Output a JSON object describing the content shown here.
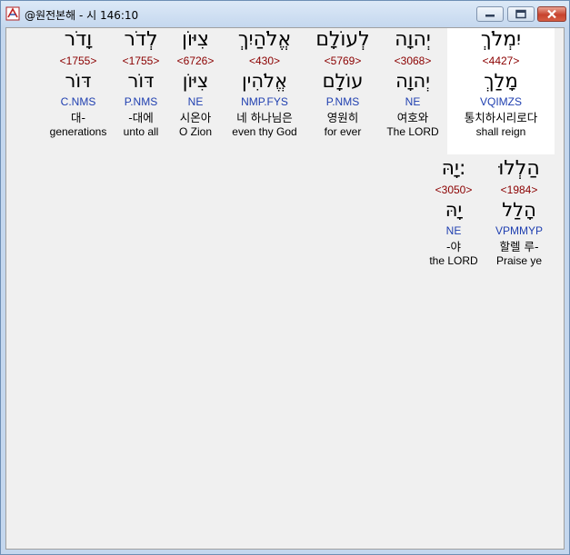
{
  "window": {
    "title": "@원전본해 - 시 146:10",
    "controls": {
      "minimize": "minimize",
      "maximize": "maximize",
      "close": "close"
    }
  },
  "row1": [
    {
      "hebrew": "יִמְלֹךְ",
      "strong": "<4427>",
      "lemma": "מָלַךְ",
      "parse": "VQIMZS",
      "korean": "통치하시리로다",
      "english": "shall reign",
      "selected": true
    },
    {
      "hebrew": "יְהוָה",
      "strong": "<3068>",
      "lemma": "יְהוָה",
      "parse": "NE",
      "korean": "여호와",
      "english": "The LORD"
    },
    {
      "hebrew": "לְעוֹלָם",
      "strong": "<5769>",
      "lemma": "עוֹלָם",
      "parse": "P.NMS",
      "korean": "영원히",
      "english": "for ever"
    },
    {
      "hebrew": "אֱלֹהַיִךְ",
      "strong": "<430>",
      "lemma": "אֱלֹהִין",
      "parse": "NMP.FYS",
      "korean": "네 하나님은",
      "english": "even thy God"
    },
    {
      "hebrew": "צִיּוֹן",
      "strong": "<6726>",
      "lemma": "צִיּוֹן",
      "parse": "NE",
      "korean": "시온아",
      "english": "O Zion"
    },
    {
      "hebrew": "לְדֹר",
      "strong": "<1755>",
      "lemma": "דּוֹר",
      "parse": "P.NMS",
      "korean": "-대에",
      "english": "unto all"
    },
    {
      "hebrew": "וָדֹר",
      "strong": "<1755>",
      "lemma": "דּוֹר",
      "parse": "C.NMS",
      "korean": "대-",
      "english": "generations"
    }
  ],
  "row2": [
    {
      "hebrew": "הַלְלוּ",
      "strong": "<1984>",
      "lemma": "הָלַל",
      "parse": "VPMMYP",
      "korean": "할렐 루-",
      "english": "Praise ye"
    },
    {
      "hebrew": "יָהּ:",
      "strong": "<3050>",
      "lemma": "יָהּ",
      "parse": "NE",
      "korean": "-야",
      "english": "the LORD"
    }
  ]
}
